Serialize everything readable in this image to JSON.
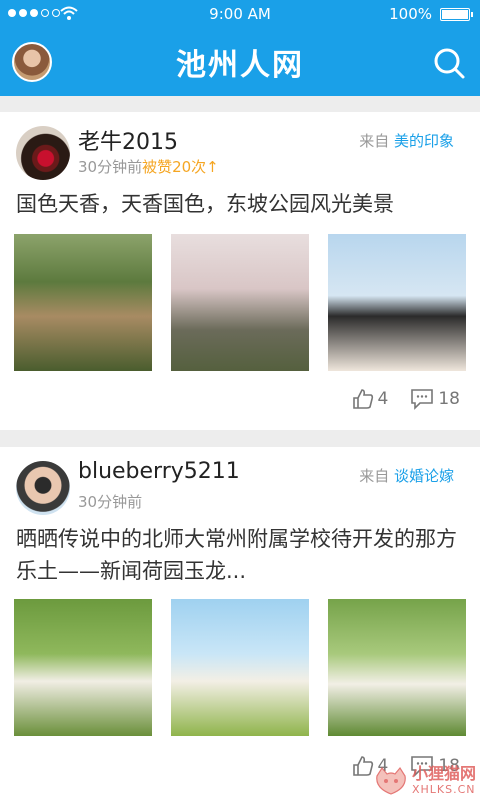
{
  "status": {
    "time": "9:00 AM",
    "battery": "100%"
  },
  "header": {
    "title": "池州人网"
  },
  "posts": [
    {
      "username": "老牛2015",
      "time_ago": "30分钟前",
      "likes_text": "被赞20次↑",
      "source_prefix": "来自",
      "source_name": "美的印象",
      "content": "国色天香，天香国色，东坡公园风光美景",
      "likes": "4",
      "comments": "18"
    },
    {
      "username": "blueberry5211",
      "time_ago": "30分钟前",
      "source_prefix": "来自",
      "source_name": "谈婚论嫁",
      "content": "晒晒传说中的北师大常州附属学校待开发的那方乐土——新闻荷园玉龙...",
      "likes": "4",
      "comments": "18"
    }
  ],
  "watermark": {
    "name": "小狸猫网",
    "domain": "XHLKS.CN"
  }
}
